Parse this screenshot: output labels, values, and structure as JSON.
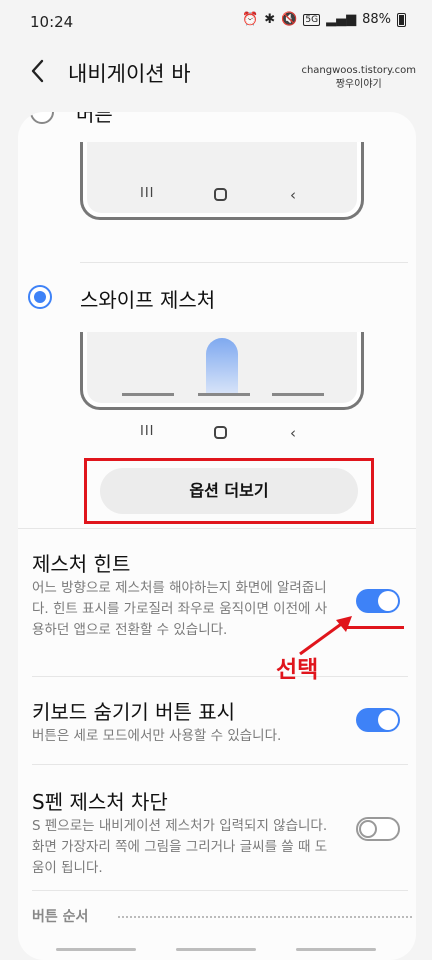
{
  "status_bar": {
    "time": "10:24",
    "icons": [
      "alarm-icon",
      "bluetooth-icon",
      "mute-icon",
      "5g-icon",
      "signal-icon"
    ],
    "network": "5G",
    "battery": "88%"
  },
  "header": {
    "title": "내비게이션 바",
    "back_icon": "‹",
    "watermark_line1": "changwoos.tistory.com",
    "watermark_line2": "짱우이야기"
  },
  "options": {
    "buttons_label": "버튼",
    "gesture_label": "스와이프 제스처",
    "selected": "gesture",
    "navkeys": {
      "recent": "III",
      "back": "‹"
    }
  },
  "more_options": {
    "label": "옵션 더보기"
  },
  "settings": [
    {
      "title": "제스처 힌트",
      "description": "어느 방향으로 제스처를 해야하는지 화면에 알려줍니다. 힌트 표시를 가로질러 좌우로 움직이면 이전에 사용하던 앱으로 전환할 수 있습니다.",
      "enabled": true
    },
    {
      "title": "키보드 숨기기 버튼 표시",
      "description": "버튼은 세로 모드에서만 사용할 수 있습니다.",
      "enabled": true
    },
    {
      "title": "S펜 제스처 차단",
      "description": "S 펜으로는 내비게이션 제스처가 입력되지 않습니다. 화면 가장자리 쪽에 그림을 그리거나 글씨를 쓸 때 도움이 됩니다.",
      "enabled": false
    }
  ],
  "button_order": {
    "label": "버튼 순서"
  },
  "annotation": {
    "text": "선택",
    "color": "#e0151c"
  },
  "colors": {
    "accent": "#3e82f7",
    "annotation": "#e0151c"
  }
}
